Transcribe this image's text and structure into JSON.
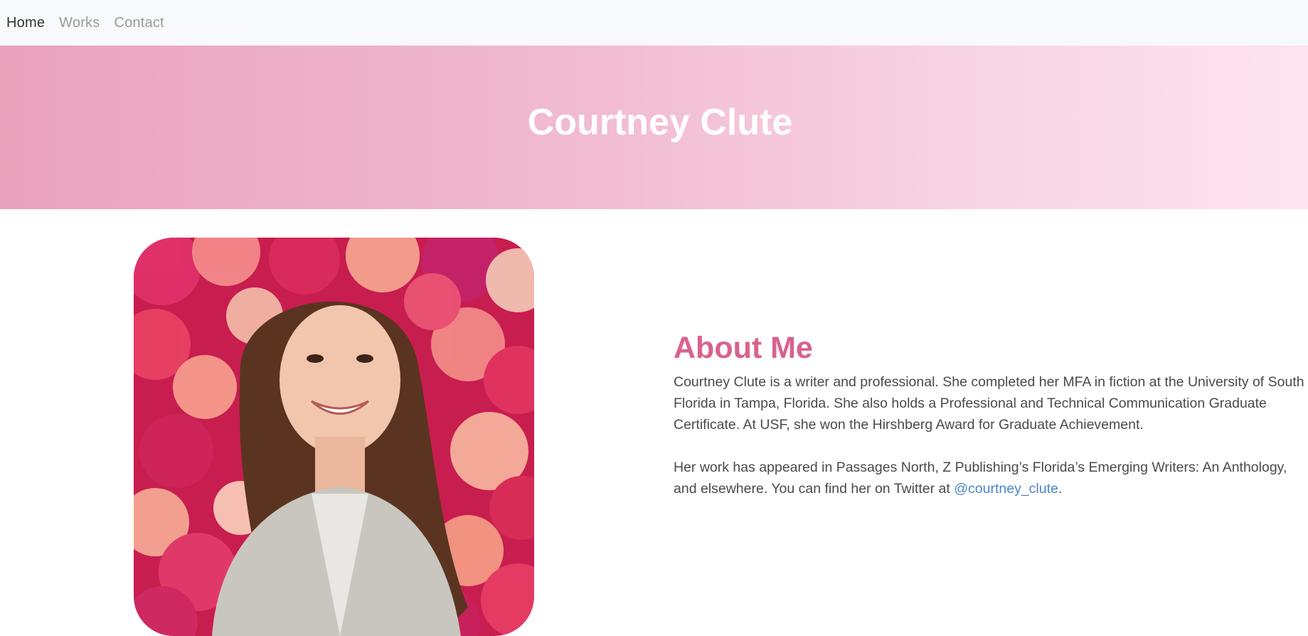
{
  "nav": {
    "items": [
      {
        "label": "Home",
        "active": true
      },
      {
        "label": "Works",
        "active": false
      },
      {
        "label": "Contact",
        "active": false
      }
    ]
  },
  "hero": {
    "title": "Courtney Clute",
    "gradient_colors": [
      "#e9a3bc",
      "#fde4ef"
    ]
  },
  "about": {
    "heading": "About Me",
    "paragraph1": "Courtney Clute is a writer and professional. She completed her MFA in fiction at the University of South Florida in Tampa, Florida. She also holds a Professional and Technical Communication Graduate Certificate. At USF, she won the Hirshberg Award for Graduate Achievement.",
    "paragraph2_before_link": "Her work has appeared in Passages North, Z Publishing’s Florida’s Emerging Writers: An Anthology, and elsewhere. You can find her on Twitter at ",
    "twitter_handle": "@courtney_clute",
    "paragraph2_after_link": "."
  },
  "colors": {
    "heading_accent": "#d9628e",
    "link": "#4a86c8",
    "navbar_bg": "#f8f9fa"
  }
}
